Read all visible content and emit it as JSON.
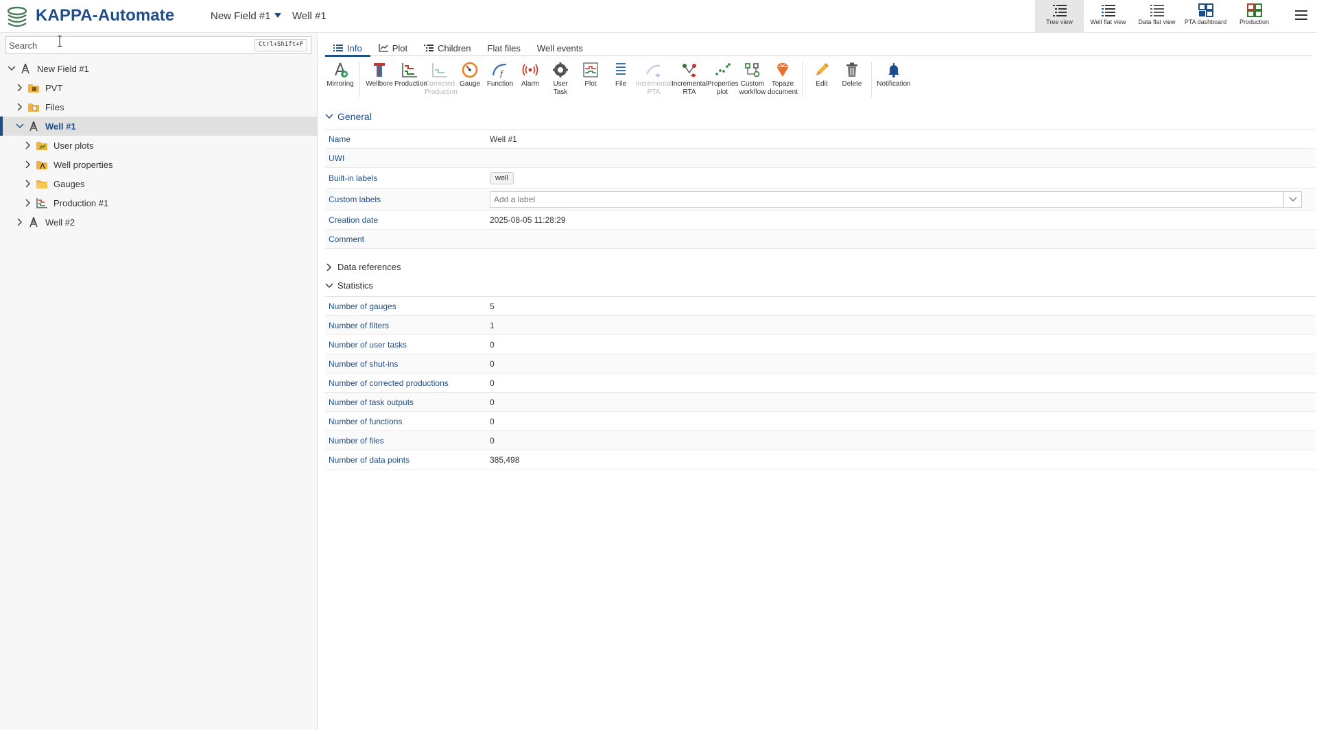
{
  "header": {
    "app_title": "KAPPA-Automate",
    "breadcrumb_field": "New Field #1",
    "breadcrumb_well": "Well #1",
    "views": [
      {
        "label": "Tree view",
        "icon": "tree-view-icon"
      },
      {
        "label": "Well flat view",
        "icon": "well-flat-view-icon"
      },
      {
        "label": "Data flat view",
        "icon": "data-flat-view-icon"
      },
      {
        "label": "PTA dashboard",
        "icon": "pta-dashboard-icon"
      },
      {
        "label": "Production",
        "icon": "production-dashboard-icon"
      }
    ],
    "active_view": "Tree view"
  },
  "search": {
    "placeholder": "Search",
    "shortcut": "Ctrl+Shift+F"
  },
  "tree": [
    {
      "label": "New Field #1",
      "icon": "field-icon"
    },
    {
      "label": "PVT",
      "icon": "pvt-folder-icon"
    },
    {
      "label": "Files",
      "icon": "files-folder-icon"
    },
    {
      "label": "Well #1",
      "icon": "well-icon",
      "selected": true
    },
    {
      "label": "User plots",
      "icon": "user-plots-folder-icon"
    },
    {
      "label": "Well properties",
      "icon": "well-properties-folder-icon"
    },
    {
      "label": "Gauges",
      "icon": "gauges-folder-icon"
    },
    {
      "label": "Production #1",
      "icon": "production-icon"
    },
    {
      "label": "Well #2",
      "icon": "well-icon"
    }
  ],
  "tabs": [
    "Info",
    "Plot",
    "Children",
    "Flat files",
    "Well events"
  ],
  "active_tab": "Info",
  "toolbar": {
    "mirroring": "Mirroring",
    "wellbore": "Wellbore",
    "production": "Production",
    "corrected_production": "Corrected Production",
    "gauge": "Gauge",
    "function": "Function",
    "alarm": "Alarm",
    "user_task": "User Task",
    "plot": "Plot",
    "file": "File",
    "incremental_pta": "Incremental PTA",
    "incremental_rta": "Incremental RTA",
    "properties_plot": "Properties plot",
    "custom_workflow": "Custom workflow",
    "topaze_document": "Topaze document",
    "edit": "Edit",
    "delete": "Delete",
    "notification": "Notification"
  },
  "general": {
    "title": "General",
    "name_label": "Name",
    "name_value": "Well #1",
    "uwi_label": "UWI",
    "uwi_value": "",
    "builtin_label": "Built-in labels",
    "builtin_chip": "well",
    "custom_label": "Custom labels",
    "custom_placeholder": "Add a label",
    "creation_label": "Creation date",
    "creation_value": "2025-08-05 11:28:29",
    "comment_label": "Comment",
    "comment_value": ""
  },
  "data_references": {
    "title": "Data references"
  },
  "statistics": {
    "title": "Statistics",
    "rows": [
      {
        "label": "Number of gauges",
        "value": "5"
      },
      {
        "label": "Number of filters",
        "value": "1"
      },
      {
        "label": "Number of user tasks",
        "value": "0"
      },
      {
        "label": "Number of shut-ins",
        "value": "0"
      },
      {
        "label": "Number of corrected productions",
        "value": "0"
      },
      {
        "label": "Number of task outputs",
        "value": "0"
      },
      {
        "label": "Number of functions",
        "value": "0"
      },
      {
        "label": "Number of files",
        "value": "0"
      },
      {
        "label": "Number of data points",
        "value": "385,498"
      }
    ]
  },
  "colors": {
    "brand": "#1d4e89",
    "selected_row": "#e0e0e0",
    "sidebar_bg": "#f7f7f7"
  }
}
